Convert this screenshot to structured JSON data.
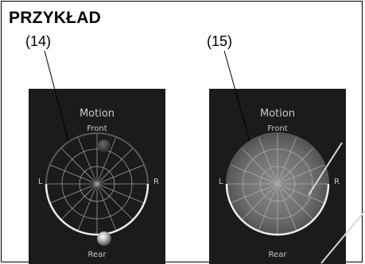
{
  "heading": "PRZYKŁAD",
  "callouts": [
    "(14)",
    "(15)"
  ],
  "panels": [
    {
      "title": "Motion",
      "front": "Front",
      "rear": "Rear",
      "left": "L",
      "right": "R",
      "state": "motion-position-markers"
    },
    {
      "title": "Motion",
      "front": "Front",
      "rear": "Rear",
      "left": "L",
      "right": "R",
      "state": "motion-area-filled"
    }
  ],
  "colors": {
    "panel_bg": "#1b1b1b",
    "ring": "#e6e6e6",
    "grid": "#9a9a9a",
    "fill": "#6a6a6a"
  }
}
